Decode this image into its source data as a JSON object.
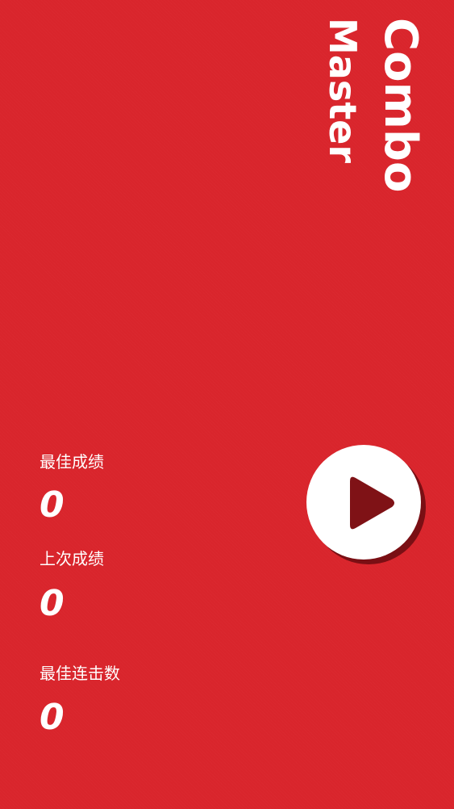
{
  "title": {
    "line1": "Combo",
    "line2": "Master"
  },
  "stats": {
    "best_score_label": "最佳成绩",
    "best_score_value": "0",
    "last_score_label": "上次成绩",
    "last_score_value": "0",
    "best_combo_label": "最佳连击数",
    "best_combo_value": "0"
  },
  "play_button": {
    "icon": "play-icon"
  },
  "colors": {
    "background": "#d9252c",
    "play_icon": "#7f1216",
    "button_shadow": "#7a0f14",
    "text": "#ffffff"
  }
}
